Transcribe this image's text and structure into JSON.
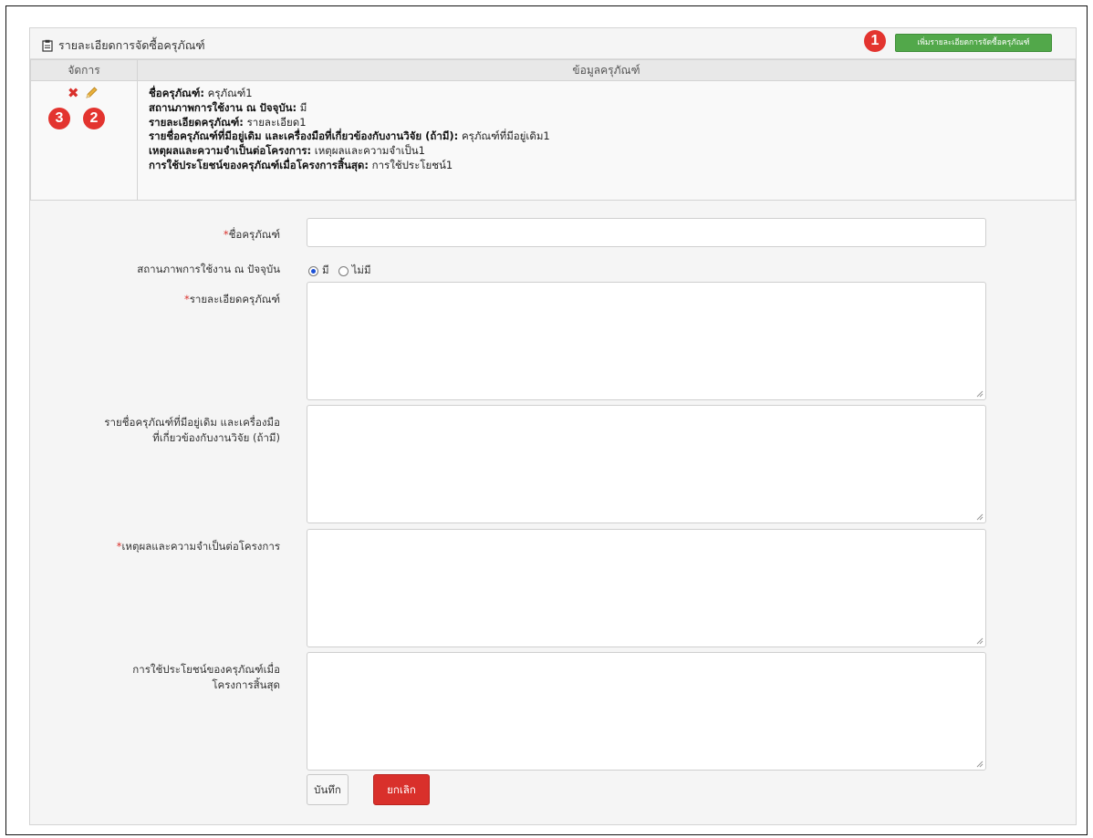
{
  "panel": {
    "title": "รายละเอียดการจัดซื้อครุภัณฑ์",
    "add_button_label": "เพิ่มรายละเอียดการจัดซื้อครุภัณฑ์"
  },
  "markers": {
    "add": "1",
    "edit": "2",
    "delete": "3"
  },
  "table": {
    "headers": [
      "จัดการ",
      "ข้อมูลครุภัณฑ์"
    ],
    "rows": [
      {
        "fields": [
          {
            "label": "ชื่อครุภัณฑ์:",
            "value": "ครุภัณฑ์1"
          },
          {
            "label": "สถานภาพการใช้งาน ณ ปัจจุบัน:",
            "value": "มี"
          },
          {
            "label": "รายละเอียดครุภัณฑ์:",
            "value": "รายละเอียด1"
          },
          {
            "label": "รายชื่อครุภัณฑ์ที่มีอยู่เดิม และเครื่องมือที่เกี่ยวข้องกับงานวิจัย (ถ้ามี):",
            "value": "ครุภัณฑ์ที่มีอยู่เดิม1"
          },
          {
            "label": "เหตุผลและความจำเป็นต่อโครงการ:",
            "value": "เหตุผลและความจำเป็น1"
          },
          {
            "label": "การใช้ประโยชน์ของครุภัณฑ์เมื่อโครงการสิ้นสุด:",
            "value": "การใช้ประโยชน์1"
          }
        ]
      }
    ]
  },
  "form": {
    "name_label": "ชื่อครุภัณฑ์",
    "status_label": "สถานภาพการใช้งาน ณ ปัจจุบัน",
    "status_options": [
      "มี",
      "ไม่มี"
    ],
    "status_selected": "มี",
    "detail_label": "รายละเอียดครุภัณฑ์",
    "existing_label_line1": "รายชื่อครุภัณฑ์ที่มีอยู่เดิม และเครื่องมือ",
    "existing_label_line2": "ที่เกี่ยวข้องกับงานวิจัย (ถ้ามี)",
    "reason_label": "เหตุผลและความจำเป็นต่อโครงการ",
    "benefit_label_line1": "การใช้ประโยชน์ของครุภัณฑ์เมื่อ",
    "benefit_label_line2": "โครงการสิ้นสุด",
    "save_label": "บันทึก",
    "cancel_label": "ยกเลิก",
    "required_mark": "*"
  }
}
